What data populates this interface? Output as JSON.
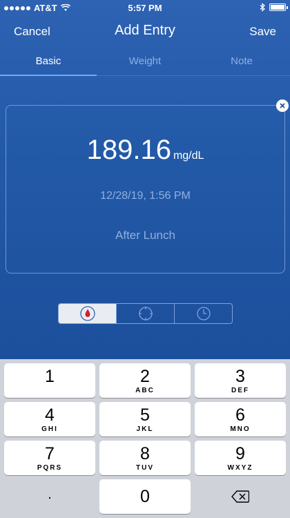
{
  "status_bar": {
    "carrier": "AT&T",
    "time": "5:57 PM"
  },
  "nav": {
    "cancel_label": "Cancel",
    "title": "Add Entry",
    "save_label": "Save"
  },
  "tabs": [
    {
      "label": "Basic",
      "active": true
    },
    {
      "label": "Weight",
      "active": false
    },
    {
      "label": "Note",
      "active": false
    }
  ],
  "entry": {
    "value": "189.16",
    "unit": "mg/dL",
    "datetime": "12/28/19, 1:56 PM",
    "meal": "After Lunch"
  },
  "segments": [
    {
      "icon": "blood-drop-icon",
      "active": true
    },
    {
      "icon": "crosshair-icon",
      "active": false
    },
    {
      "icon": "clock-icon",
      "active": false
    }
  ],
  "keypad": {
    "keys": [
      {
        "num": "1",
        "letters": ""
      },
      {
        "num": "2",
        "letters": "ABC"
      },
      {
        "num": "3",
        "letters": "DEF"
      },
      {
        "num": "4",
        "letters": "GHI"
      },
      {
        "num": "5",
        "letters": "JKL"
      },
      {
        "num": "6",
        "letters": "MNO"
      },
      {
        "num": "7",
        "letters": "PQRS"
      },
      {
        "num": "8",
        "letters": "TUV"
      },
      {
        "num": "9",
        "letters": "WXYZ"
      }
    ],
    "dot": ".",
    "zero": "0"
  },
  "colors": {
    "accent": "#235aa8",
    "tab_muted": "#8fb0e0",
    "drop_red": "#d0202f"
  }
}
